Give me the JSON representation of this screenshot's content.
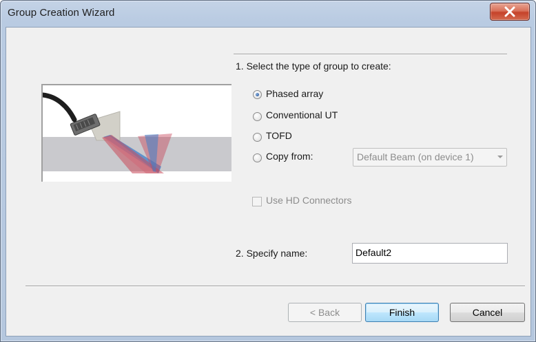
{
  "window": {
    "title": "Group Creation Wizard",
    "close_icon": "close-x-icon"
  },
  "step1": {
    "heading": "1. Select the type of group to create:",
    "options": [
      {
        "label": "Phased array",
        "checked": true
      },
      {
        "label": "Conventional UT",
        "checked": false
      },
      {
        "label": "TOFD",
        "checked": false
      },
      {
        "label": "Copy from:",
        "checked": false
      }
    ],
    "copy_from_select": "Default Beam (on device 1)",
    "hd_connectors_label": "Use HD Connectors",
    "hd_connectors_checked": false
  },
  "step2": {
    "label": "2. Specify name:",
    "name_value": "Default2"
  },
  "buttons": {
    "back": "< Back",
    "finish": "Finish",
    "cancel": "Cancel"
  },
  "colors": {
    "beam_red": "#c8485a",
    "beam_blue": "#3f7fc8",
    "part_gray": "#c8c8cc"
  }
}
